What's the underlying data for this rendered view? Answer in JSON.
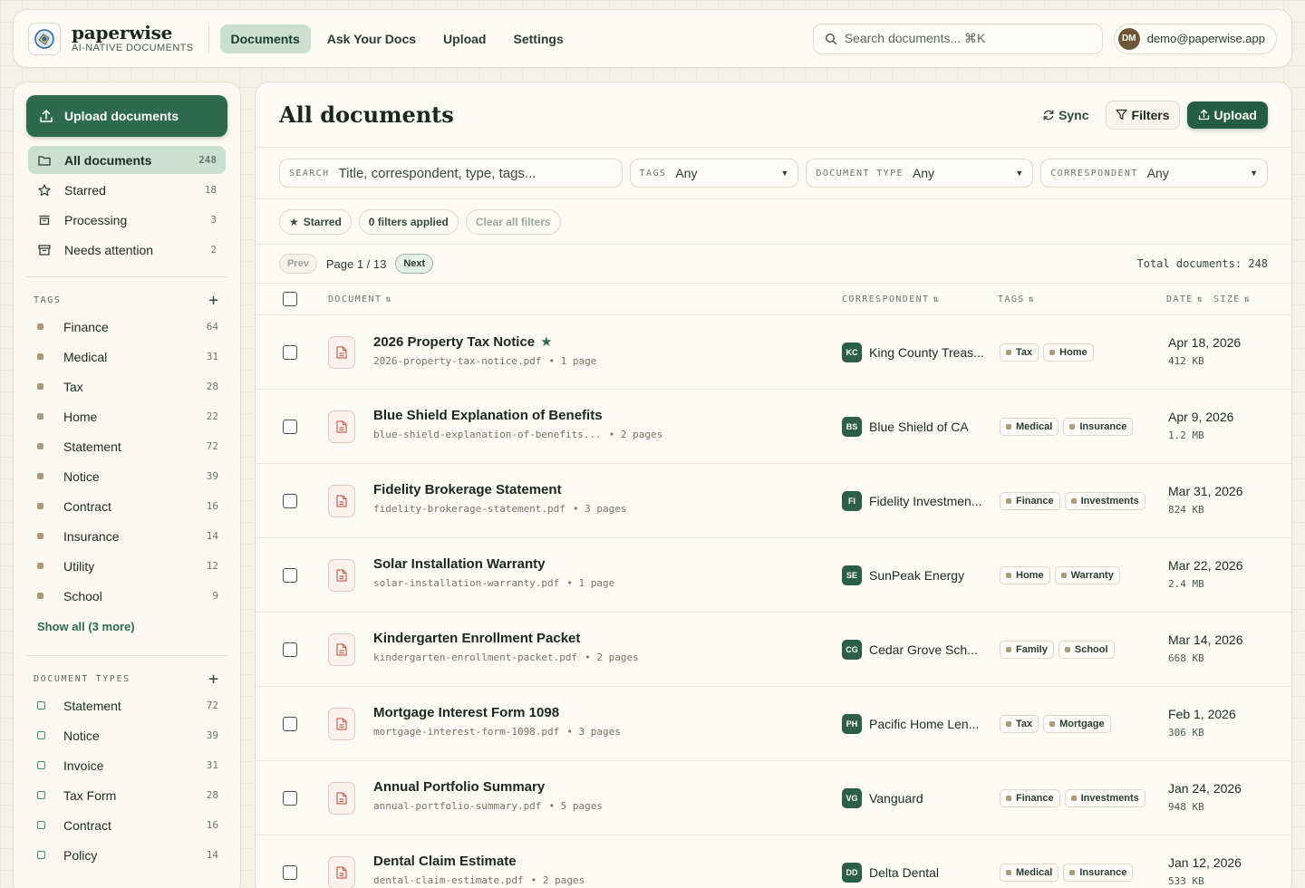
{
  "brand": {
    "name": "paperwise",
    "tagline": "AI-NATIVE DOCUMENTS"
  },
  "nav": [
    {
      "label": "Documents",
      "active": true
    },
    {
      "label": "Ask Your Docs",
      "active": false
    },
    {
      "label": "Upload",
      "active": false
    },
    {
      "label": "Settings",
      "active": false
    }
  ],
  "top_search": {
    "placeholder": "Search documents... ⌘K"
  },
  "user": {
    "initials": "DM",
    "email": "demo@paperwise.app"
  },
  "sidebar": {
    "upload_label": "Upload documents",
    "views": [
      {
        "label": "All documents",
        "count": "248",
        "icon": "folder-icon",
        "active": true
      },
      {
        "label": "Starred",
        "count": "18",
        "icon": "star-icon",
        "active": false
      },
      {
        "label": "Processing",
        "count": "3",
        "icon": "inbox-icon",
        "active": false
      },
      {
        "label": "Needs attention",
        "count": "2",
        "icon": "archive-icon",
        "active": false
      }
    ],
    "tags_heading": "TAGS",
    "tags": [
      {
        "label": "Finance",
        "count": "64"
      },
      {
        "label": "Medical",
        "count": "31"
      },
      {
        "label": "Tax",
        "count": "28"
      },
      {
        "label": "Home",
        "count": "22"
      },
      {
        "label": "Statement",
        "count": "72"
      },
      {
        "label": "Notice",
        "count": "39"
      },
      {
        "label": "Contract",
        "count": "16"
      },
      {
        "label": "Insurance",
        "count": "14"
      },
      {
        "label": "Utility",
        "count": "12"
      },
      {
        "label": "School",
        "count": "9"
      }
    ],
    "show_all": "Show all (3 more)",
    "types_heading": "DOCUMENT TYPES",
    "types": [
      {
        "label": "Statement",
        "count": "72"
      },
      {
        "label": "Notice",
        "count": "39"
      },
      {
        "label": "Invoice",
        "count": "31"
      },
      {
        "label": "Tax Form",
        "count": "28"
      },
      {
        "label": "Contract",
        "count": "16"
      },
      {
        "label": "Policy",
        "count": "14"
      }
    ]
  },
  "main": {
    "title": "All documents",
    "sync_label": "Sync",
    "filters_label": "Filters",
    "upload_label": "Upload",
    "search": {
      "label": "SEARCH",
      "placeholder": "Title, correspondent, type, tags..."
    },
    "tags_filter": {
      "label": "TAGS",
      "value": "Any"
    },
    "type_filter": {
      "label": "DOCUMENT TYPE",
      "value": "Any"
    },
    "corr_filter": {
      "label": "CORRESPONDENT",
      "value": "Any"
    },
    "chips": {
      "starred": "Starred",
      "applied": "0 filters applied",
      "clear": "Clear all filters"
    },
    "pager": {
      "prev": "Prev",
      "page": "Page 1 / 13",
      "next": "Next",
      "total": "Total documents: 248"
    },
    "columns": {
      "document": "DOCUMENT",
      "correspondent": "CORRESPONDENT",
      "tags": "TAGS",
      "date": "DATE",
      "size": "SIZE"
    },
    "rows": [
      {
        "title": "2026 Property Tax Notice",
        "starred": true,
        "file": "2026-property-tax-notice.pdf",
        "pages": "• 1 page",
        "corr_initials": "KC",
        "corr": "King County Treas...",
        "tags": [
          "Tax",
          "Home"
        ],
        "date": "Apr 18, 2026",
        "size": "412 KB"
      },
      {
        "title": "Blue Shield Explanation of Benefits",
        "starred": false,
        "file": "blue-shield-explanation-of-benefits...",
        "pages": "• 2 pages",
        "corr_initials": "BS",
        "corr": "Blue Shield of CA",
        "tags": [
          "Medical",
          "Insurance"
        ],
        "date": "Apr 9, 2026",
        "size": "1.2 MB"
      },
      {
        "title": "Fidelity Brokerage Statement",
        "starred": false,
        "file": "fidelity-brokerage-statement.pdf",
        "pages": "• 3 pages",
        "corr_initials": "FI",
        "corr": "Fidelity Investmen...",
        "tags": [
          "Finance",
          "Investments"
        ],
        "date": "Mar 31, 2026",
        "size": "824 KB"
      },
      {
        "title": "Solar Installation Warranty",
        "starred": false,
        "file": "solar-installation-warranty.pdf",
        "pages": "• 1 page",
        "corr_initials": "SE",
        "corr": "SunPeak Energy",
        "tags": [
          "Home",
          "Warranty"
        ],
        "date": "Mar 22, 2026",
        "size": "2.4 MB"
      },
      {
        "title": "Kindergarten Enrollment Packet",
        "starred": false,
        "file": "kindergarten-enrollment-packet.pdf",
        "pages": "• 2 pages",
        "corr_initials": "CG",
        "corr": "Cedar Grove Sch...",
        "tags": [
          "Family",
          "School"
        ],
        "date": "Mar 14, 2026",
        "size": "668 KB"
      },
      {
        "title": "Mortgage Interest Form 1098",
        "starred": false,
        "file": "mortgage-interest-form-1098.pdf",
        "pages": "• 3 pages",
        "corr_initials": "PH",
        "corr": "Pacific Home Len...",
        "tags": [
          "Tax",
          "Mortgage"
        ],
        "date": "Feb 1, 2026",
        "size": "306 KB"
      },
      {
        "title": "Annual Portfolio Summary",
        "starred": false,
        "file": "annual-portfolio-summary.pdf",
        "pages": "• 5 pages",
        "corr_initials": "VG",
        "corr": "Vanguard",
        "tags": [
          "Finance",
          "Investments"
        ],
        "date": "Jan 24, 2026",
        "size": "948 KB"
      },
      {
        "title": "Dental Claim Estimate",
        "starred": false,
        "file": "dental-claim-estimate.pdf",
        "pages": "• 2 pages",
        "corr_initials": "DD",
        "corr": "Delta Dental",
        "tags": [
          "Medical",
          "Insurance"
        ],
        "date": "Jan 12, 2026",
        "size": "533 KB"
      }
    ]
  }
}
